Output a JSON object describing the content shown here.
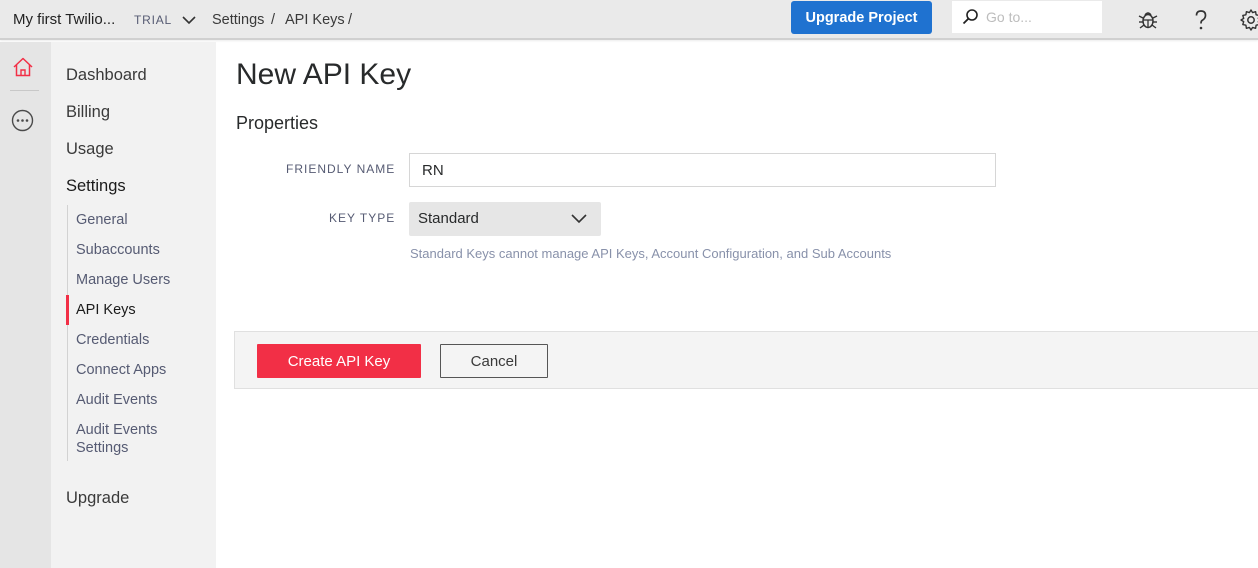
{
  "header": {
    "project_name": "My first Twilio...",
    "account_status": "TRIAL",
    "breadcrumbs": [
      "Settings",
      "API Keys"
    ],
    "breadcrumb_separator": "/",
    "upgrade_label": "Upgrade Project",
    "search_placeholder": "Go to...",
    "icons": [
      "chevron-down-icon",
      "search-icon",
      "bug-icon",
      "help-icon",
      "gear-icon"
    ]
  },
  "rail": {
    "icons": [
      "home-icon",
      "more-icon"
    ],
    "active_icon_color": "#f22f46"
  },
  "sidebar": {
    "items": [
      "Dashboard",
      "Billing",
      "Usage",
      "Settings"
    ],
    "settings_subitems": [
      "General",
      "Subaccounts",
      "Manage Users",
      "API Keys",
      "Credentials",
      "Connect Apps",
      "Audit Events Settings"
    ],
    "active_subitem": "API Keys",
    "bottom_item": "Upgrade"
  },
  "main": {
    "title": "New API Key",
    "section_title": "Properties",
    "friendly_name_label": "FRIENDLY NAME",
    "friendly_name_value": "RN",
    "key_type_label": "KEY TYPE",
    "key_type_value": "Standard",
    "key_type_help": "Standard Keys cannot manage API Keys, Account Configuration, and Sub Accounts",
    "create_label": "Create API Key",
    "cancel_label": "Cancel"
  },
  "colors": {
    "brand_red": "#f22f46",
    "upgrade_blue": "#1f72d0",
    "topbar_bg": "#eaeaea",
    "sidebar_bg": "#f2f2f2"
  }
}
